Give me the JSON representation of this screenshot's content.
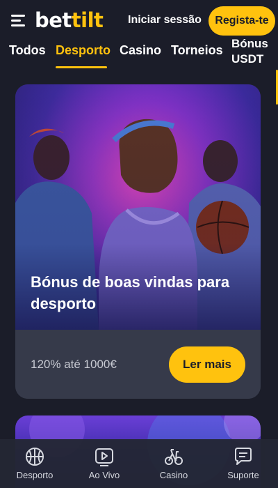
{
  "header": {
    "logo_part1": "bet",
    "logo_part2": "tilt",
    "login_label": "Iniciar sessão",
    "register_label": "Regista-te"
  },
  "tabs": [
    {
      "label": "Todos",
      "active": false
    },
    {
      "label": "Desporto",
      "active": true
    },
    {
      "label": "Casino",
      "active": false
    },
    {
      "label": "Torneios",
      "active": false
    },
    {
      "label": "Bónus USDT",
      "active": false
    }
  ],
  "promo": {
    "title": "Bónus de boas vindas para desporto",
    "text": "120% até 1000€",
    "button_label": "Ler mais"
  },
  "bottom_nav": [
    {
      "label": "Desporto",
      "icon": "basketball-icon"
    },
    {
      "label": "Ao Vivo",
      "icon": "live-video-icon"
    },
    {
      "label": "Casino",
      "icon": "casino-bike-icon"
    },
    {
      "label": "Suporte",
      "icon": "chat-icon"
    }
  ],
  "colors": {
    "accent": "#ffc20e",
    "background": "#1b1d29",
    "card": "#363a4a"
  }
}
